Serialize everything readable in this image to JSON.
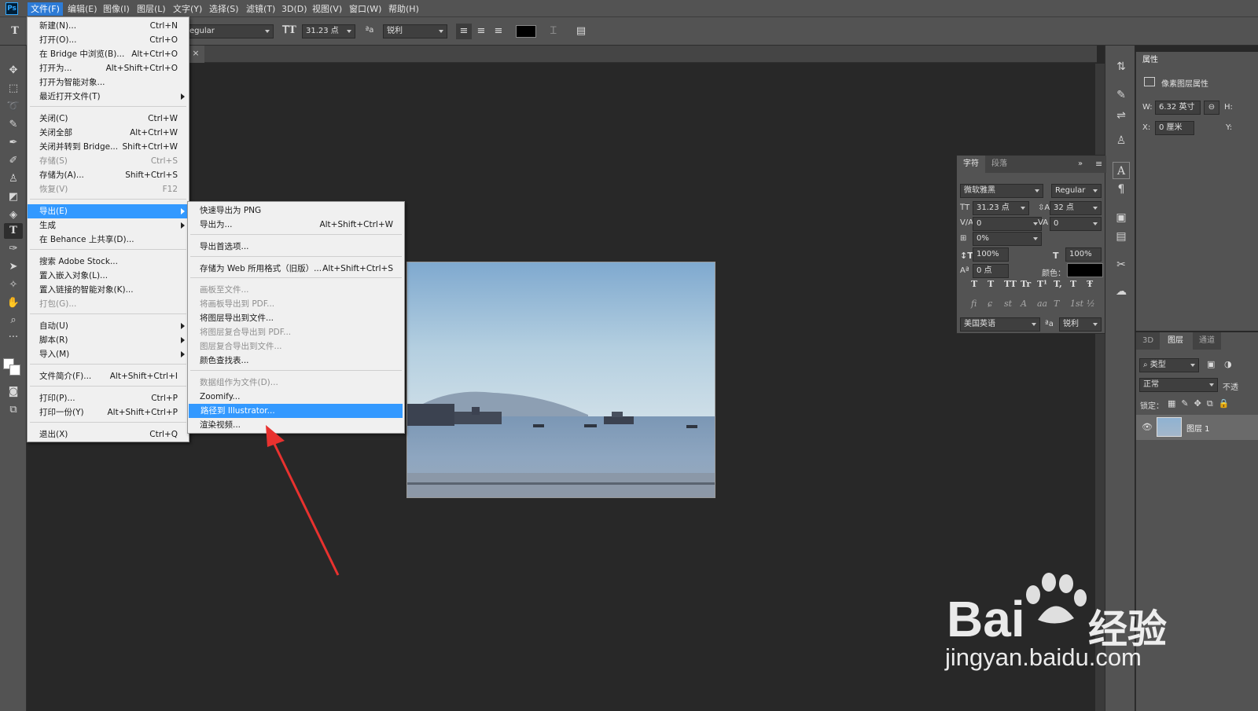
{
  "app": {
    "logo": "Ps"
  },
  "menubar": [
    "文件(F)",
    "编辑(E)",
    "图像(I)",
    "图层(L)",
    "文字(Y)",
    "选择(S)",
    "滤镜(T)",
    "3D(D)",
    "视图(V)",
    "窗口(W)",
    "帮助(H)"
  ],
  "options": {
    "font_style": "egular",
    "size": "31.23 点",
    "aa_icon": "aa-icon",
    "antialias": "锐利"
  },
  "file_menu": [
    {
      "label": "新建(N)...",
      "shortcut": "Ctrl+N"
    },
    {
      "label": "打开(O)...",
      "shortcut": "Ctrl+O"
    },
    {
      "label": "在 Bridge 中浏览(B)...",
      "shortcut": "Alt+Ctrl+O"
    },
    {
      "label": "打开为...",
      "shortcut": "Alt+Shift+Ctrl+O"
    },
    {
      "label": "打开为智能对象...",
      "shortcut": ""
    },
    {
      "label": "最近打开文件(T)",
      "shortcut": ""
    },
    {
      "label": "关闭(C)",
      "shortcut": "Ctrl+W"
    },
    {
      "label": "关闭全部",
      "shortcut": "Alt+Ctrl+W"
    },
    {
      "label": "关闭并转到 Bridge...",
      "shortcut": "Shift+Ctrl+W"
    },
    {
      "label": "存储(S)",
      "shortcut": "Ctrl+S"
    },
    {
      "label": "存储为(A)...",
      "shortcut": "Shift+Ctrl+S"
    },
    {
      "label": "恢复(V)",
      "shortcut": "F12"
    },
    {
      "label": "导出(E)",
      "shortcut": ""
    },
    {
      "label": "生成",
      "shortcut": ""
    },
    {
      "label": "在 Behance 上共享(D)...",
      "shortcut": ""
    },
    {
      "label": "搜索 Adobe Stock...",
      "shortcut": ""
    },
    {
      "label": "置入嵌入对象(L)...",
      "shortcut": ""
    },
    {
      "label": "置入链接的智能对象(K)...",
      "shortcut": ""
    },
    {
      "label": "打包(G)...",
      "shortcut": ""
    },
    {
      "label": "自动(U)",
      "shortcut": ""
    },
    {
      "label": "脚本(R)",
      "shortcut": ""
    },
    {
      "label": "导入(M)",
      "shortcut": ""
    },
    {
      "label": "文件简介(F)...",
      "shortcut": "Alt+Shift+Ctrl+I"
    },
    {
      "label": "打印(P)...",
      "shortcut": "Ctrl+P"
    },
    {
      "label": "打印一份(Y)",
      "shortcut": "Alt+Shift+Ctrl+P"
    },
    {
      "label": "退出(X)",
      "shortcut": "Ctrl+Q"
    }
  ],
  "export_menu": [
    {
      "label": "快速导出为 PNG",
      "shortcut": ""
    },
    {
      "label": "导出为...",
      "shortcut": "Alt+Shift+Ctrl+W"
    },
    {
      "label": "导出首选项...",
      "shortcut": ""
    },
    {
      "label": "存储为 Web 所用格式（旧版）...",
      "shortcut": "Alt+Shift+Ctrl+S"
    },
    {
      "label": "画板至文件...",
      "shortcut": ""
    },
    {
      "label": "将画板导出到 PDF...",
      "shortcut": ""
    },
    {
      "label": "将图层导出到文件...",
      "shortcut": ""
    },
    {
      "label": "将图层复合导出到 PDF...",
      "shortcut": ""
    },
    {
      "label": "图层复合导出到文件...",
      "shortcut": ""
    },
    {
      "label": "颜色查找表...",
      "shortcut": ""
    },
    {
      "label": "数据组作为文件(D)...",
      "shortcut": ""
    },
    {
      "label": "Zoomify...",
      "shortcut": ""
    },
    {
      "label": "路径到 Illustrator...",
      "shortcut": ""
    },
    {
      "label": "渲染视频...",
      "shortcut": ""
    }
  ],
  "char_panel": {
    "tab_char": "字符",
    "tab_para": "段落",
    "font": "微软雅黑",
    "style": "Regular",
    "size": "31.23 点",
    "leading": "32 点",
    "kerning": "0",
    "tracking": "0",
    "scale_pct": "0%",
    "vscale": "100%",
    "hscale": "100%",
    "baseline": "0 点",
    "color_label": "颜色：",
    "color": "#000000",
    "language": "美国英语",
    "aa": "锐利",
    "styles1": [
      "T",
      "T",
      "TT",
      "Tr",
      "T¹",
      "T,",
      "T",
      "Ŧ"
    ],
    "styles2": [
      "fi",
      "ɕ",
      "st",
      "A",
      "aa",
      "T",
      "1st",
      "½"
    ]
  },
  "properties": {
    "tab": "属性",
    "title": "像素图层属性",
    "w_label": "W:",
    "w_value": "6.32 英寸",
    "h_label": "H:",
    "x_label": "X:",
    "x_value": "0 厘米",
    "y_label": "Y:"
  },
  "layers_panel": {
    "tabs": [
      "3D",
      "图层",
      "通道"
    ],
    "filter": "类型",
    "blend": "正常",
    "opacity_label": "不透",
    "lock_label": "锁定：",
    "layer_name": "图层 1"
  },
  "watermark": {
    "text1": "Bai",
    "text2": "经验",
    "url": "jingyan.baidu.com"
  }
}
